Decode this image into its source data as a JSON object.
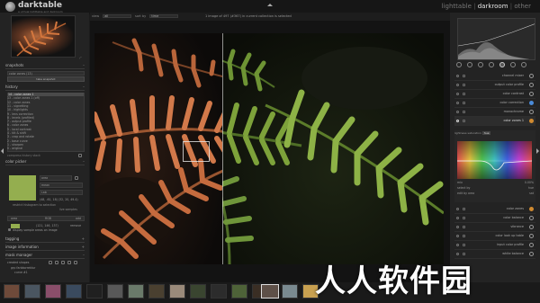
{
  "app": {
    "name": "darktable",
    "tagline": "a virtual lighttable and darkroom"
  },
  "modes": {
    "lighttable": "lighttable",
    "darkroom": "darkroom",
    "other": "other",
    "sep": "|",
    "active": "darkroom"
  },
  "filterbar": {
    "view_label": "view",
    "view_value": "all",
    "sort_label": "sort by",
    "sort_value": "time",
    "status": "1 image of 497 (#367) in current collection is selected"
  },
  "left_panel": {
    "snapshots": {
      "title": "snapshots",
      "item": "color zones (13)",
      "take_label": "take snapshot"
    },
    "history": {
      "title": "history",
      "items": [
        "14 - color zones 1",
        "13 - color zones 1 (off)",
        "12 - color zones",
        "11 - vignetting",
        "10 - highlights",
        "9 - lens correction",
        "8 - levels (profiled)",
        "7 - output profile",
        "6 - color zones",
        "5 - local contrast",
        "4 - tilt & shift",
        "3 - crop and rotate",
        "2 - base curve",
        "1 - sharpen",
        "0 - original"
      ],
      "compress_label": "compress history stack"
    },
    "color_picker": {
      "title": "color picker",
      "mode_label": "area",
      "stat_label": "mean",
      "space_label": "Lab",
      "values": "(48, -61, 18) (32, 20, 49.4)",
      "restrict_label": "restrict histogram to selection",
      "live_label": "live samples",
      "add_label": "add",
      "space2_label": "RGB",
      "sample_values": "(121, 146, 137)",
      "remove_label": "remove",
      "display_label": "display sample areas on image"
    },
    "tagging": {
      "title": "tagging"
    },
    "image_info": {
      "title": "image information"
    },
    "mask_manager": {
      "title": "mask manager",
      "created_label": "created shapes",
      "group_label": "grp farbkorrektur",
      "curve_label": "curve #1"
    }
  },
  "right_panel": {
    "modules": [
      {
        "label": "channel mixer",
        "icon_color": "#999999"
      },
      {
        "label": "output color profile",
        "icon_color": "#999999"
      },
      {
        "label": "color contrast",
        "icon_color": "#999999"
      },
      {
        "label": "color correction",
        "icon_color": "#4a8ad8"
      },
      {
        "label": "monochrome",
        "icon_color": "#999999"
      },
      {
        "label": "color zones 1",
        "icon_color": "#d08a30"
      }
    ],
    "color_zones_tabs": [
      "lightness",
      "saturation",
      "hue"
    ],
    "color_zones_active": "hue",
    "slider_labels": [
      "mix",
      "select by",
      "edit by area"
    ],
    "slider_values": [
      "0.00%",
      "hue",
      "sat"
    ],
    "lower_modules": [
      {
        "label": "color zones",
        "icon_color": "#d08a30"
      },
      {
        "label": "color balance",
        "icon_color": "#999999"
      },
      {
        "label": "vibrance",
        "icon_color": "#999999"
      },
      {
        "label": "color look up table",
        "icon_color": "#999999"
      },
      {
        "label": "input color profile",
        "icon_color": "#999999"
      },
      {
        "label": "white balance",
        "icon_color": "#999999"
      }
    ]
  },
  "watermark": "人人软件园"
}
